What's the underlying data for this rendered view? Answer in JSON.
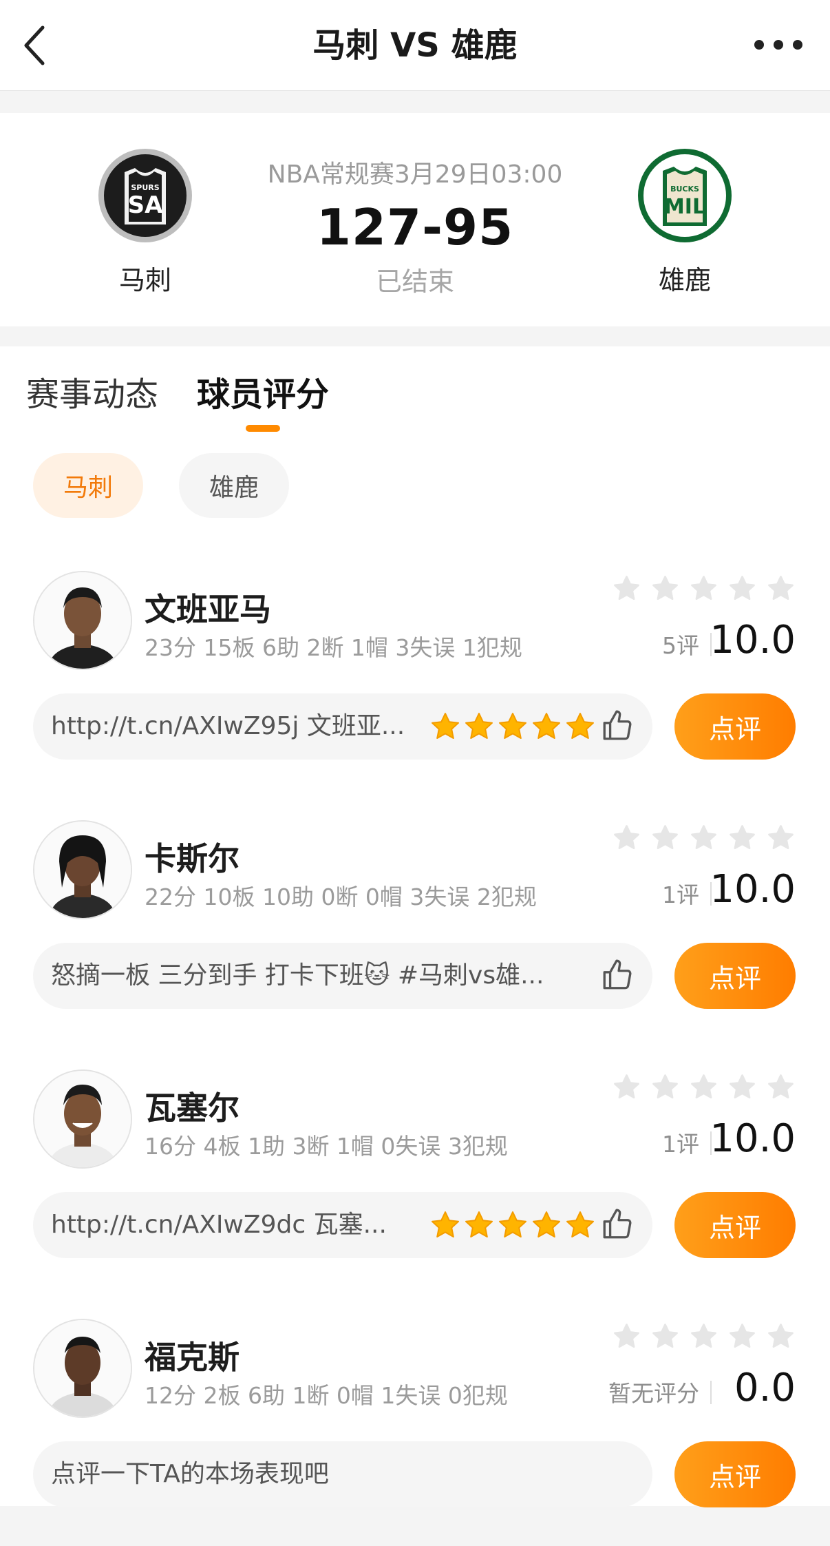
{
  "header": {
    "title": "马刺 VS 雄鹿"
  },
  "match": {
    "home_team": "马刺",
    "away_team": "雄鹿",
    "home_logo_text_top": "SPURS",
    "home_logo_text_main": "SA",
    "away_logo_text_top": "BUCKS",
    "away_logo_text_main": "MIL",
    "league_time": "NBA常规赛3月29日03:00",
    "score": "127-95",
    "status": "已结束"
  },
  "tabs": [
    {
      "label": "赛事动态",
      "active": false
    },
    {
      "label": "球员评分",
      "active": true
    }
  ],
  "team_filter": [
    {
      "label": "马刺",
      "active": true
    },
    {
      "label": "雄鹿",
      "active": false
    }
  ],
  "players": [
    {
      "name": "文班亚马",
      "stats": "23分 15板 6助 2断 1帽 3失误 1犯规",
      "rating_count": "5评",
      "rating": "10.0",
      "comment": "http://t.cn/AXIwZ95j 文班亚...",
      "comment_stars": 5,
      "review_label": "点评"
    },
    {
      "name": "卡斯尔",
      "stats": "22分 10板 10助 0断 0帽 3失误 2犯规",
      "rating_count": "1评",
      "rating": "10.0",
      "comment": "怒摘一板 三分到手 打卡下班🐱 #马刺vs雄...",
      "comment_stars": 0,
      "review_label": "点评"
    },
    {
      "name": "瓦塞尔",
      "stats": "16分 4板 1助 3断 1帽 0失误 3犯规",
      "rating_count": "1评",
      "rating": "10.0",
      "comment": "http://t.cn/AXIwZ9dc 瓦塞...",
      "comment_stars": 5,
      "review_label": "点评"
    },
    {
      "name": "福克斯",
      "stats": "12分 2板 6助 1断 0帽 1失误 0犯规",
      "rating_count": "暂无评分",
      "rating": "0.0",
      "comment": "点评一下TA的本场表现吧",
      "comment_stars": 0,
      "review_label": "点评"
    }
  ],
  "colors": {
    "accent": "#ff8a00",
    "star_empty": "#e6e6e6",
    "star_full": "#ffb400"
  }
}
